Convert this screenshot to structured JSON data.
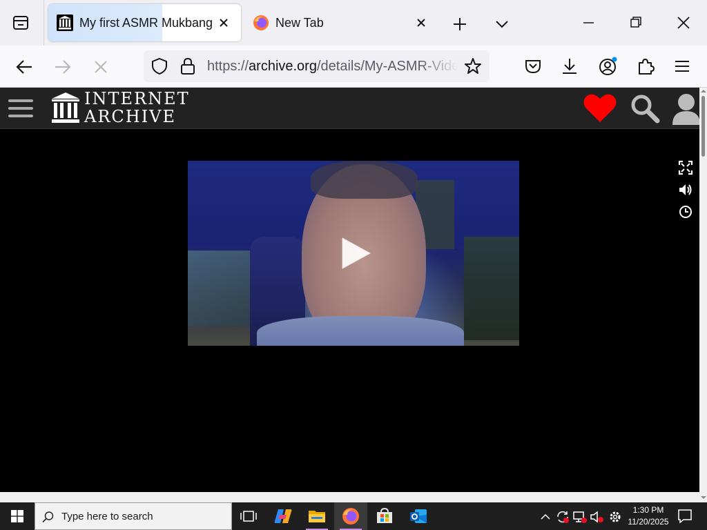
{
  "browser": {
    "tabs": [
      {
        "title": "My first ASMR Mukbang",
        "favicon": "internet-archive-icon",
        "active": true
      },
      {
        "title": "New Tab",
        "favicon": "firefox-icon",
        "active": false
      }
    ],
    "url": {
      "scheme": "https://",
      "host": "archive.org",
      "path": "/details/My-ASMR-Video"
    },
    "accent": "#0061e0"
  },
  "site": {
    "logo_line1": "INTERNET",
    "logo_line2": "ARCHIVE",
    "heart_color": "#ff0000"
  },
  "video": {
    "state": "paused"
  },
  "taskbar": {
    "search_placeholder": "Type here to search",
    "time": "1:30 PM",
    "date": "11/20/2025"
  }
}
